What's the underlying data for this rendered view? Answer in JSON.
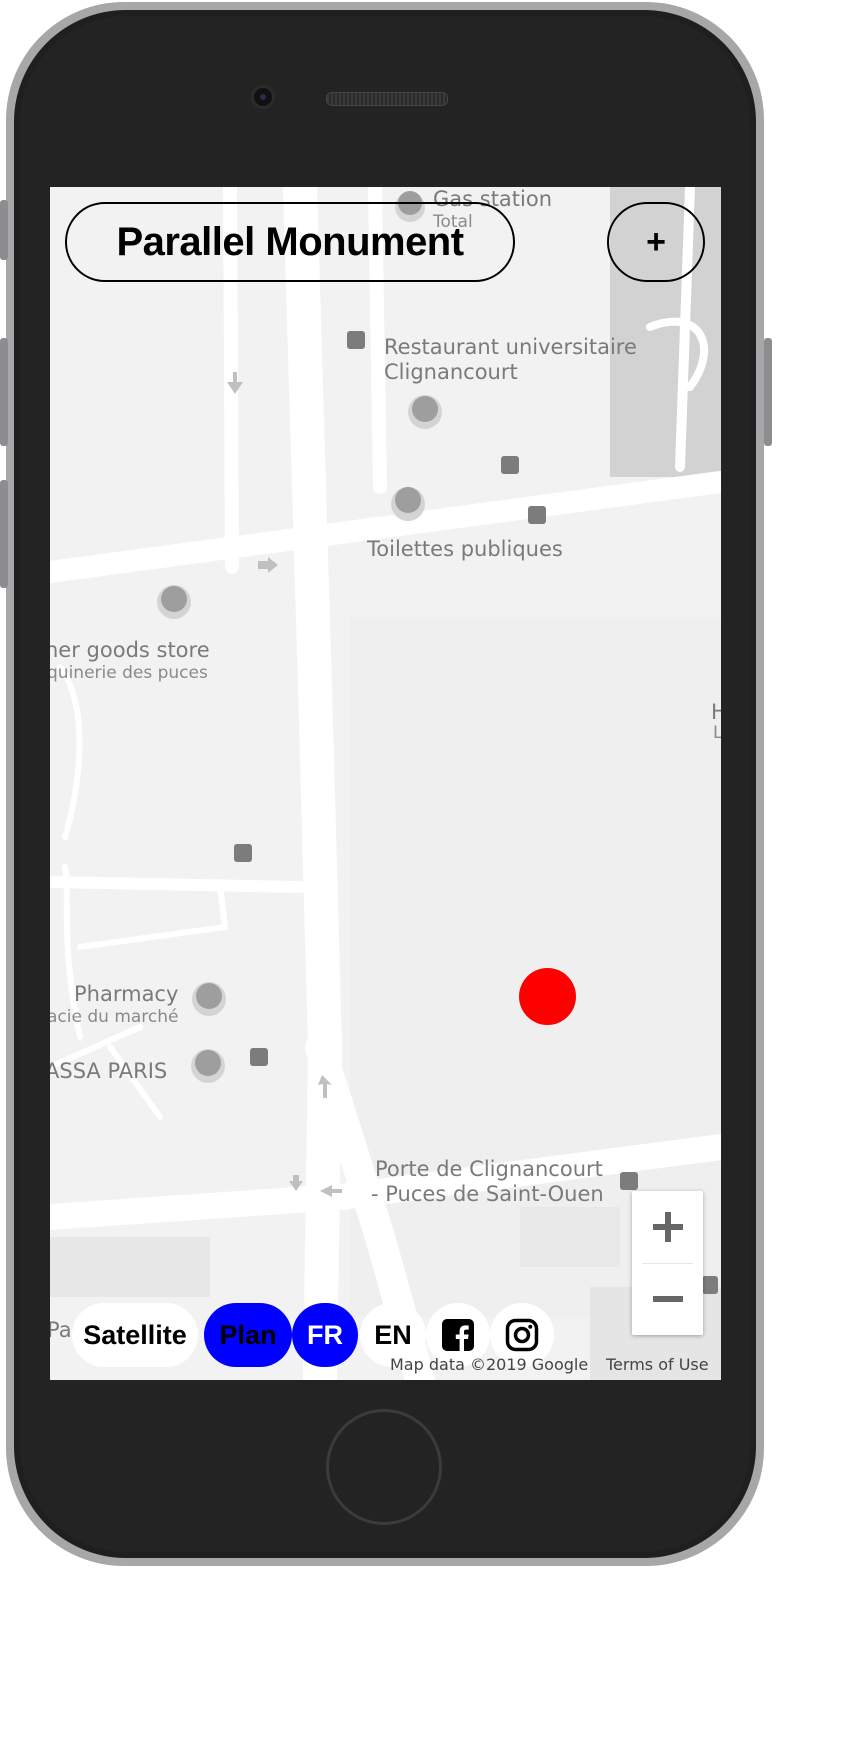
{
  "app": {
    "title": "Parallel Monument",
    "add_label": "+"
  },
  "map": {
    "labels": [
      {
        "id": "gas",
        "text": "Gas station",
        "sub": "Total"
      },
      {
        "id": "restaurant",
        "text": "Restaurant universitaire",
        "text2": "Clignancourt"
      },
      {
        "id": "toilets",
        "text": "Toilettes publiques"
      },
      {
        "id": "goods",
        "text": "her goods store",
        "sub": "quinerie des puces"
      },
      {
        "id": "pharmacy",
        "text": "Pharmacy",
        "sub": "acie du marché"
      },
      {
        "id": "assa",
        "text": "ASSA PARIS"
      },
      {
        "id": "metro",
        "text": "Porte de Clignancourt",
        "text2": "- Puces de Saint-Ouen"
      },
      {
        "id": "edge",
        "text": "H",
        "sub": "L"
      },
      {
        "id": "pa",
        "text": "Pa"
      }
    ],
    "marker_color": "#ff0000"
  },
  "controls": {
    "zoom_in": "+",
    "zoom_out": "−"
  },
  "bottom": {
    "satellite": "Satellite",
    "plan": "Plan",
    "fr": "FR",
    "en": "EN",
    "active_color": "#0000ff",
    "icons": [
      "facebook-icon",
      "instagram-icon"
    ]
  },
  "footer": {
    "map_data": "Map data ©2019 Google",
    "terms": "Terms of Use"
  }
}
